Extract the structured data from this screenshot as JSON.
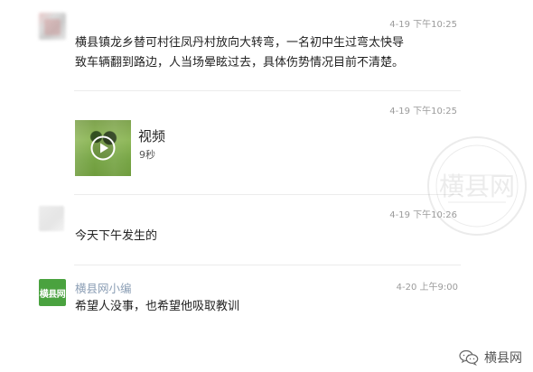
{
  "thread": {
    "messages": [
      {
        "avatar": "blurred-avatar",
        "timestamp": "4-19 下午10:25",
        "text_lines": [
          "横县镇龙乡替可村往凤丹村放向大转弯，一名初中生过弯太快导",
          "致车辆翻到路边，人当场晕眩过去，具体伤势情况目前不清楚。"
        ]
      },
      {
        "avatar": "blurred-avatar",
        "timestamp": "4-19 下午10:25",
        "video": {
          "title": "视频",
          "duration": "9秒"
        }
      },
      {
        "avatar": "blurred-avatar",
        "timestamp": "4-19 下午10:26",
        "text": "今天下午发生的"
      },
      {
        "sender": "横县网小编",
        "avatar_label": "横县网",
        "timestamp": "4-20 上午9:00",
        "text": "希望人没事，也希望他吸取教训"
      }
    ]
  },
  "watermark": {
    "text": "横县网"
  },
  "footer": {
    "brand_name": "横县网"
  },
  "colors": {
    "divider": "#ececec",
    "timestamp": "#9b9b9b",
    "sender": "#8a9db4",
    "logo_bg": "#4aa23f"
  }
}
